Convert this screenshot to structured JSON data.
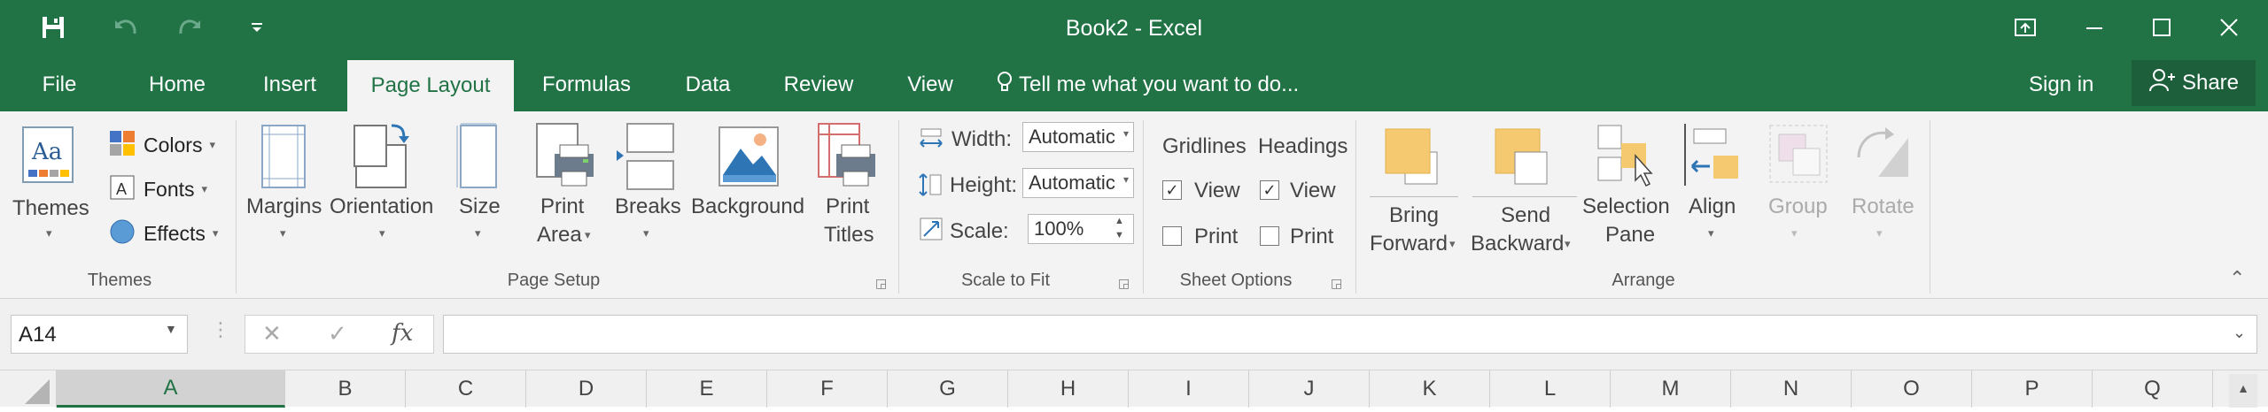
{
  "window": {
    "title": "Book2 - Excel"
  },
  "qat": {
    "icons": [
      "save-icon",
      "undo-icon",
      "redo-icon",
      "customize-qat-icon"
    ]
  },
  "window_controls": [
    "ribbon-display-icon",
    "minimize-icon",
    "maximize-icon",
    "close-icon"
  ],
  "tabs": {
    "file": "File",
    "home": "Home",
    "insert": "Insert",
    "page_layout": "Page Layout",
    "formulas": "Formulas",
    "data": "Data",
    "review": "Review",
    "view": "View",
    "tell_me": "Tell me what you want to do...",
    "sign_in": "Sign in",
    "share": "Share"
  },
  "ribbon": {
    "themes": {
      "themes": "Themes",
      "colors": "Colors",
      "fonts": "Fonts",
      "effects": "Effects",
      "group": "Themes"
    },
    "page_setup": {
      "margins": "Margins",
      "orientation": "Orientation",
      "size": "Size",
      "print_area_1": "Print",
      "print_area_2": "Area",
      "breaks": "Breaks",
      "background": "Background",
      "print_titles_1": "Print",
      "print_titles_2": "Titles",
      "group": "Page Setup"
    },
    "scale_to_fit": {
      "width_label": "Width:",
      "width_value": "Automatic",
      "height_label": "Height:",
      "height_value": "Automatic",
      "scale_label": "Scale:",
      "scale_value": "100%",
      "group": "Scale to Fit"
    },
    "sheet_options": {
      "gridlines": "Gridlines",
      "headings": "Headings",
      "view": "View",
      "print": "Print",
      "gridlines_view": true,
      "gridlines_print": false,
      "headings_view": true,
      "headings_print": false,
      "group": "Sheet Options"
    },
    "arrange": {
      "bring_1": "Bring",
      "bring_2": "Forward",
      "send_1": "Send",
      "send_2": "Backward",
      "selection_1": "Selection",
      "selection_2": "Pane",
      "align": "Align",
      "group_btn": "Group",
      "rotate": "Rotate",
      "group": "Arrange"
    }
  },
  "formula_bar": {
    "name_box": "A14",
    "fx": "fx",
    "value": ""
  },
  "columns": [
    "A",
    "B",
    "C",
    "D",
    "E",
    "F",
    "G",
    "H",
    "I",
    "J",
    "K",
    "L",
    "M",
    "N",
    "O",
    "P",
    "Q"
  ],
  "selected_column": "A",
  "colors": {
    "accent": "#217346",
    "ribbon": "#f3f3f3"
  }
}
